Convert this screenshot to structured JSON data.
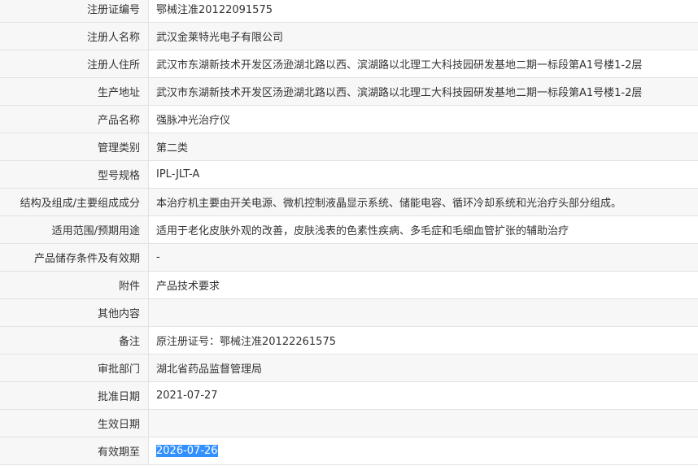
{
  "record": {
    "rows": [
      {
        "label": "注册证编号",
        "value": "鄂械注准20122091575"
      },
      {
        "label": "注册人名称",
        "value": "武汉金莱特光电子有限公司"
      },
      {
        "label": "注册人住所",
        "value": "武汉市东湖新技术开发区汤逊湖北路以西、滨湖路以北理工大科技园研发基地二期一标段第A1号楼1-2层"
      },
      {
        "label": "生产地址",
        "value": "武汉市东湖新技术开发区汤逊湖北路以西、滨湖路以北理工大科技园研发基地二期一标段第A1号楼1-2层"
      },
      {
        "label": "产品名称",
        "value": "强脉冲光治疗仪"
      },
      {
        "label": "管理类别",
        "value": "第二类"
      },
      {
        "label": "型号规格",
        "value": "IPL-JLT-A"
      },
      {
        "label": "结构及组成/主要组成成分",
        "value": "本治疗机主要由开关电源、微机控制液晶显示系统、储能电容、循环冷却系统和光治疗头部分组成。"
      },
      {
        "label": "适用范围/预期用途",
        "value": "适用于老化皮肤外观的改善，皮肤浅表的色素性疾病、多毛症和毛细血管扩张的辅助治疗"
      },
      {
        "label": "产品储存条件及有效期",
        "value": "-"
      },
      {
        "label": "附件",
        "value": "产品技术要求"
      },
      {
        "label": "其他内容",
        "value": ""
      },
      {
        "label": "备注",
        "value": "原注册证号：鄂械注准20122261575"
      },
      {
        "label": "审批部门",
        "value": "湖北省药品监督管理局"
      },
      {
        "label": "批准日期",
        "value": "2021-07-27"
      },
      {
        "label": "生效日期",
        "value": ""
      },
      {
        "label": "有效期至",
        "value": "2026-07-26"
      }
    ]
  },
  "colors": {
    "label_bg": "#f7f7f7",
    "border": "#e2e2e2",
    "text": "#333333",
    "selection": "#3390ff"
  }
}
